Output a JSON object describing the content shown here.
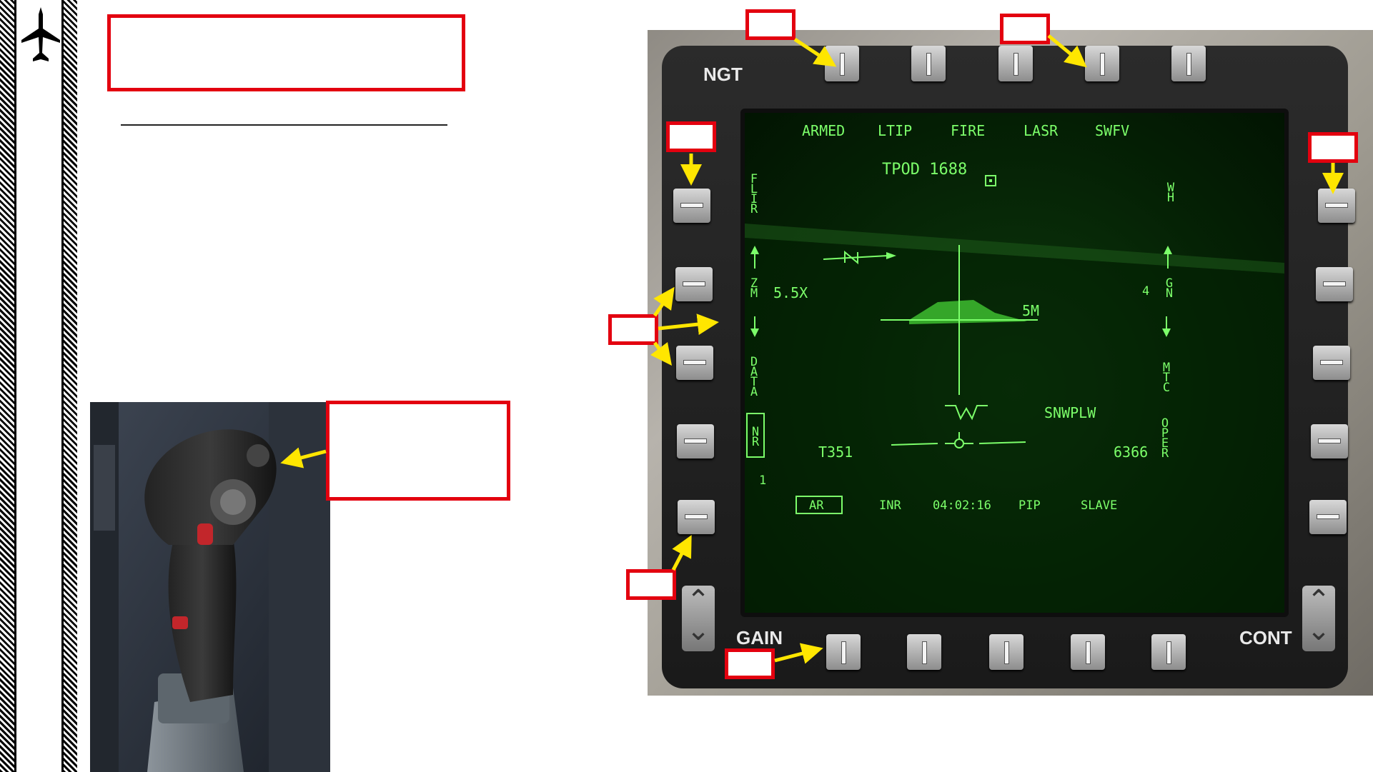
{
  "page": {
    "sidebar_icon": "aircraft-icon",
    "title_box_text": "",
    "stick_callout_text": ""
  },
  "mfd": {
    "corner_left_label": "NGT",
    "bottom_left_label": "GAIN",
    "bottom_right_label": "CONT",
    "top_options": [
      "ARMED",
      "LTIP",
      "FIRE",
      "LASR",
      "SWFV"
    ],
    "bottom_options": [
      "AR",
      "INR",
      "04:02:16",
      "PIP",
      "SLAVE"
    ],
    "left_options": [
      "FLIR",
      "ZM",
      "DATA",
      "NR"
    ],
    "right_options": [
      "WH",
      "GN",
      "MTC",
      "OPER"
    ],
    "tpod_label": "TPOD 1688",
    "zoom_value": "5.5X",
    "gain_value": "4",
    "range_label": "5M",
    "snowplow": "SNWPLW",
    "track_label": "T351",
    "altitude_label": "6366",
    "small_value": "1",
    "colors": {
      "symbology": "#7cff6a",
      "callout": "#e3000f",
      "arrow": "#ffe600"
    }
  }
}
